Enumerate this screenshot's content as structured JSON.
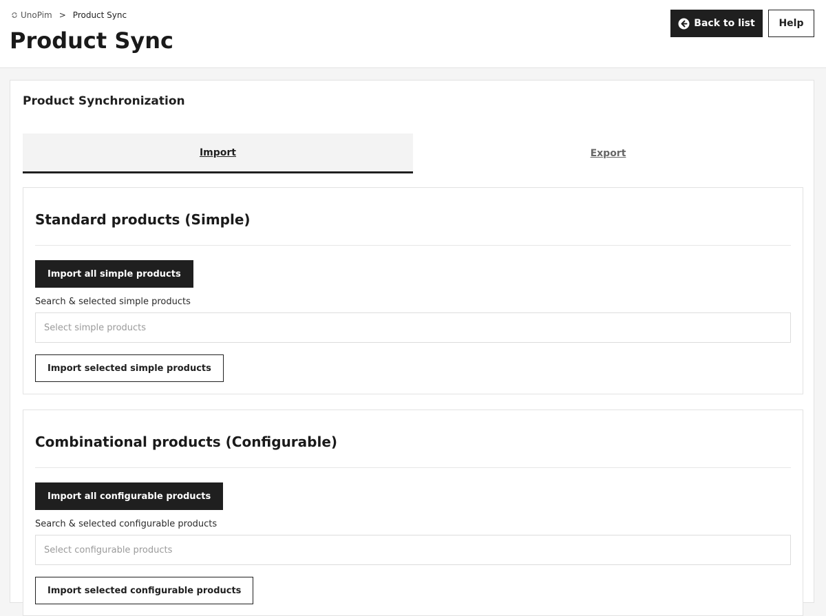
{
  "breadcrumb": {
    "root_icon": "sync-icon",
    "root": "UnoPim",
    "separator": ">",
    "current": "Product Sync"
  },
  "page": {
    "title": "Product Sync"
  },
  "header_actions": {
    "back_label": "Back to list",
    "back_icon": "arrow-left-circle-icon",
    "help_label": "Help"
  },
  "card": {
    "title": "Product Synchronization"
  },
  "tabs": [
    {
      "label": "Import",
      "active": true
    },
    {
      "label": "Export",
      "active": false
    }
  ],
  "sections": [
    {
      "title": "Standard products (Simple)",
      "import_all_label": "Import all simple products",
      "search_label": "Search & selected simple products",
      "search_placeholder": "Select simple products",
      "import_selected_label": "Import selected simple products"
    },
    {
      "title": "Combinational products (Configurable)",
      "import_all_label": "Import all configurable products",
      "search_label": "Search & selected configurable products",
      "search_placeholder": "Select configurable products",
      "import_selected_label": "Import selected configurable products"
    }
  ],
  "colors": {
    "primary": "#1f1f1f",
    "background": "#f5f5f5",
    "border": "#e2e2e2"
  }
}
